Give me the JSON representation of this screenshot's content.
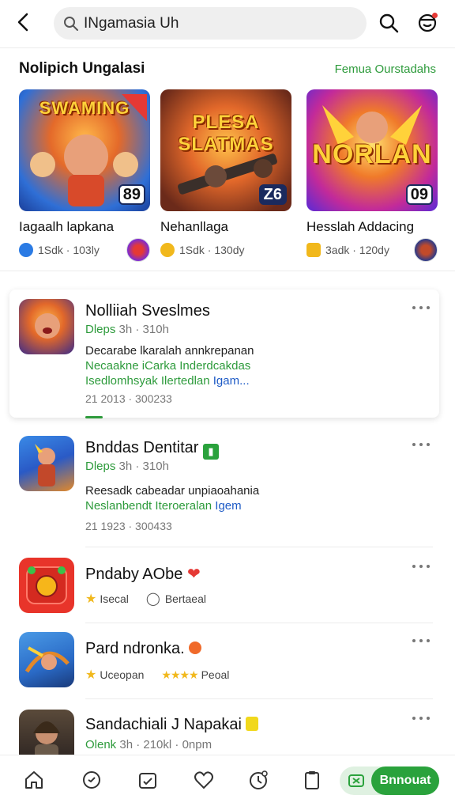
{
  "search": {
    "value": "INgamasia Uh"
  },
  "section": {
    "title": "Nolipich Ungalasi",
    "link": "Femua Ourstadahs"
  },
  "featured": [
    {
      "thumb_title": "SWAMING",
      "badge": "89",
      "name": "Iagaalh lapkana",
      "meta": "1Sdk · 103ly",
      "accent": "#2b7be4"
    },
    {
      "thumb_title": "PLESA SLATMAS",
      "badge": "Z6",
      "name": "Nehanllaga",
      "meta": "1Sdk · 130dy",
      "accent": "#f1b81c"
    },
    {
      "thumb_title": "NORLAN",
      "badge": "09",
      "name": "Hesslah Addacing",
      "meta": "3adk · 120dy",
      "accent": "#f1b81c"
    }
  ],
  "list": [
    {
      "title": "Nolliiah Sveslmes",
      "sub_green": "Dleps",
      "sub_gray": "3h · 310h",
      "desc1": "Decarabe lkaralah annkrepanan",
      "desc2": "Necaakne iCarka Inderdcakdas",
      "desc3": "Isedlomhsyak Ilertedlan",
      "desc3_link": "Igam...",
      "date": "21 2013 · 300233"
    },
    {
      "title": "Bnddas Dentitar",
      "sub_green": "Dleps",
      "sub_gray": "3h · 310h",
      "desc1": "Reesadk cabeadar unpiaoahania",
      "desc2": "Neslanbendt Iteroeralan",
      "desc2_link": "Igem",
      "date": "21 1923 · 300433"
    },
    {
      "title": "Pndaby AObe",
      "tag1": "Isecal",
      "tag2": "Bertaeal"
    },
    {
      "title": "Pard ndronka.",
      "tag1": "Uceopan",
      "tag2": "Peoal"
    },
    {
      "title": "Sandachiali J Napakai",
      "sub_green": "Olenk",
      "sub_gray": "3h · 210kl · 0npm"
    }
  ],
  "nav": {
    "pill_label": "Bnnouat"
  },
  "colors": {
    "accent_green": "#2aa23c",
    "link_green": "#2e9b3c",
    "link_blue": "#1e5bc6",
    "notif_red": "#e53935"
  }
}
